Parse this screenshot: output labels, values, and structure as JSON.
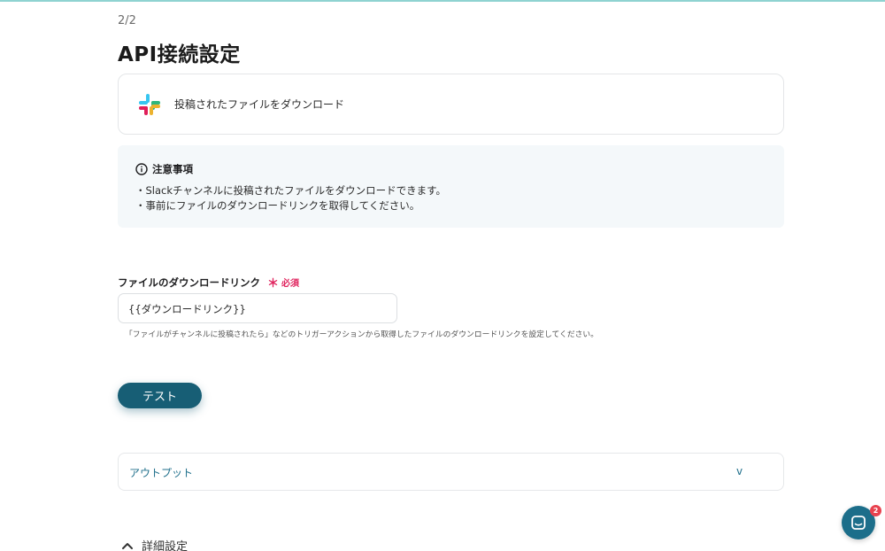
{
  "step_indicator": "2/2",
  "page_title": "API接続設定",
  "action": {
    "label": "投稿されたファイルをダウンロード",
    "app_icon": "slack-icon"
  },
  "notice": {
    "title": "注意事項",
    "lines": [
      "・Slackチャンネルに投稿されたファイルをダウンロードできます。",
      "・事前にファイルのダウンロードリンクを取得してください。"
    ]
  },
  "field": {
    "label": "ファイルのダウンロードリンク",
    "required_mark": "＊",
    "required_text": "必須",
    "value": "{{ダウンロードリンク}}",
    "hint": "「ファイルがチャンネルに投稿されたら」などのトリガーアクションから取得したファイルのダウンロードリンクを設定してください。"
  },
  "test_button": "テスト",
  "output": {
    "label": "アウトプット",
    "chevron": "v"
  },
  "advanced": {
    "label": "詳細設定"
  },
  "chat": {
    "badge_count": "2"
  },
  "colors": {
    "primary": "#175e75",
    "required": "#e0245e",
    "notice_bg": "#f4f8fa",
    "badge": "#e8424f"
  }
}
